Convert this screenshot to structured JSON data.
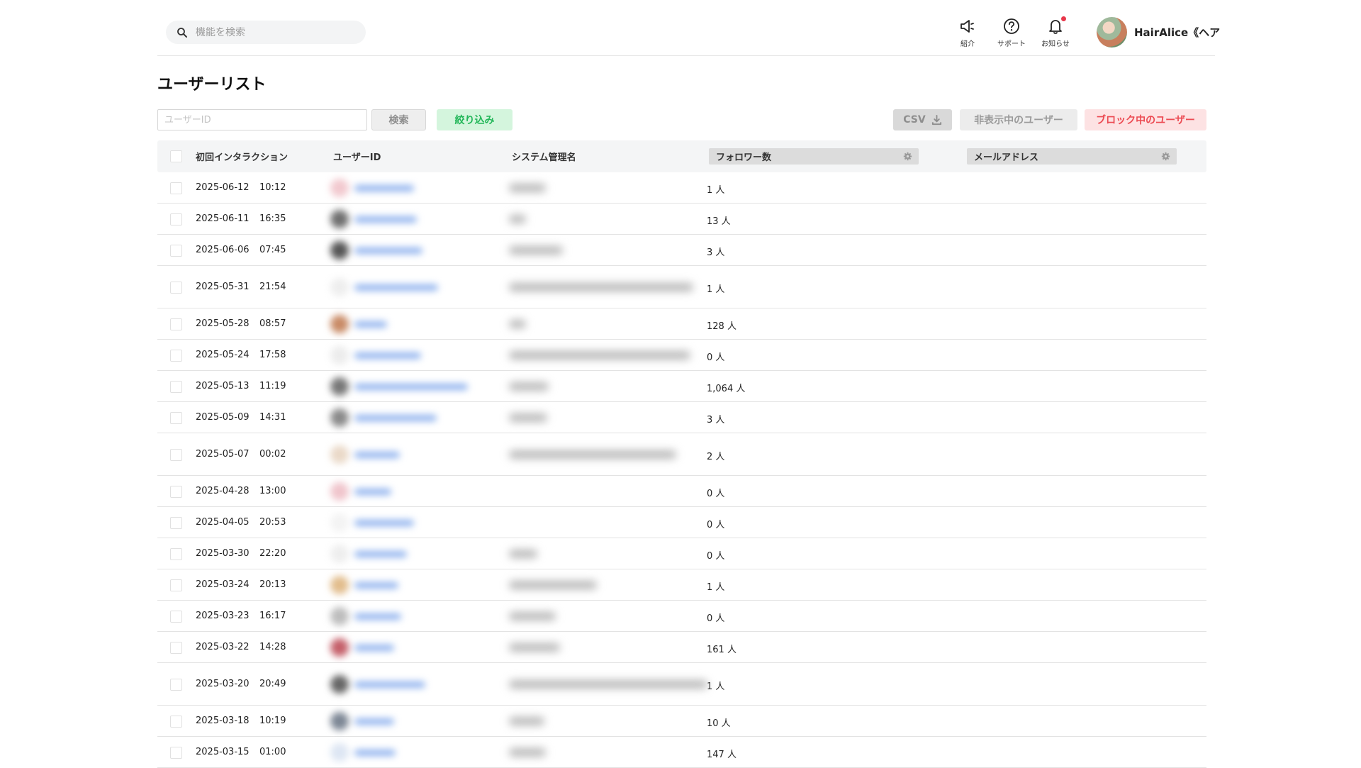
{
  "header": {
    "search_placeholder": "機能を検索",
    "icons": [
      {
        "name": "intro",
        "label": "紹介"
      },
      {
        "name": "support",
        "label": "サポート"
      },
      {
        "name": "notice",
        "label": "お知らせ"
      }
    ],
    "profile_name": "HairAlice《ヘア"
  },
  "page": {
    "title": "ユーザーリスト"
  },
  "toolbar": {
    "uid_placeholder": "ユーザーID",
    "search_label": "検索",
    "filter_label": "絞り込み",
    "csv_label": "CSV",
    "hidden_users_label": "非表示中のユーザー",
    "blocked_users_label": "ブロック中のユーザー"
  },
  "table": {
    "columns": {
      "first_interaction": "初回インタラクション",
      "user_id": "ユーザーID",
      "system_name": "システム管理名",
      "followers": "フォロワー数",
      "email": "メールアドレス"
    },
    "rows": [
      {
        "date": "2025-06-12",
        "time": "10:12",
        "followers": "1 人"
      },
      {
        "date": "2025-06-11",
        "time": "16:35",
        "followers": "13 人"
      },
      {
        "date": "2025-06-06",
        "time": "07:45",
        "followers": "3 人"
      },
      {
        "date": "2025-05-31",
        "time": "21:54",
        "followers": "1 人"
      },
      {
        "date": "2025-05-28",
        "time": "08:57",
        "followers": "128 人"
      },
      {
        "date": "2025-05-24",
        "time": "17:58",
        "followers": "0 人"
      },
      {
        "date": "2025-05-13",
        "time": "11:19",
        "followers": "1,064 人"
      },
      {
        "date": "2025-05-09",
        "time": "14:31",
        "followers": "3 人"
      },
      {
        "date": "2025-05-07",
        "time": "00:02",
        "followers": "2 人"
      },
      {
        "date": "2025-04-28",
        "time": "13:00",
        "followers": "0 人"
      },
      {
        "date": "2025-04-05",
        "time": "20:53",
        "followers": "0 人"
      },
      {
        "date": "2025-03-30",
        "time": "22:20",
        "followers": "0 人"
      },
      {
        "date": "2025-03-24",
        "time": "20:13",
        "followers": "1 人"
      },
      {
        "date": "2025-03-23",
        "time": "16:17",
        "followers": "0 人"
      },
      {
        "date": "2025-03-22",
        "time": "14:28",
        "followers": "161 人"
      },
      {
        "date": "2025-03-20",
        "time": "20:49",
        "followers": "1 人"
      },
      {
        "date": "2025-03-18",
        "time": "10:19",
        "followers": "10 人"
      },
      {
        "date": "2025-03-15",
        "time": "01:00",
        "followers": "147 人"
      }
    ]
  },
  "colors": {
    "accent_green": "#24b75a",
    "accent_red": "#ec4a52",
    "link_blue": "#8fb2ee",
    "notification_dot": "#e8374a"
  }
}
